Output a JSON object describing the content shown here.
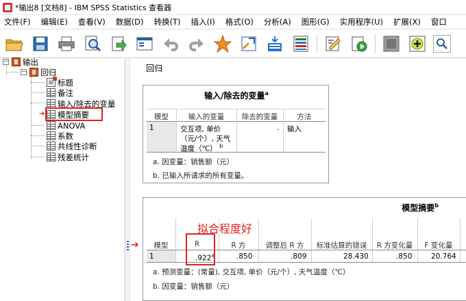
{
  "window": {
    "title": "*输出8 [文档8] - IBM SPSS Statistics 查看器"
  },
  "menu": [
    "文件(F)",
    "编辑(E)",
    "查看(V)",
    "数据(D)",
    "转换(T)",
    "插入(I)",
    "格式(O)",
    "分析(A)",
    "图形(G)",
    "实用程序(U)",
    "扩展(X)",
    "窗口"
  ],
  "toolbar": {
    "icons": [
      "open-folder-icon",
      "save-icon",
      "print-icon",
      "print-preview-icon",
      "export-icon",
      "recall-dialog-icon",
      "undo-icon",
      "redo-icon",
      "goto-data-icon",
      "goto-case-icon",
      "goto-variable-icon",
      "variables-icon",
      "show-all-icon",
      "run-icon",
      "designate-window-icon",
      "insert-icon",
      "search-icon"
    ]
  },
  "navigator": {
    "items": [
      {
        "label": "输出",
        "icon": "book-icon",
        "level": 0
      },
      {
        "label": "回归",
        "icon": "book-icon",
        "level": 1
      },
      {
        "label": "标题",
        "icon": "doc-icon",
        "level": 2
      },
      {
        "label": "备注",
        "icon": "table-icon",
        "level": 2
      },
      {
        "label": "输入/除去的变量",
        "icon": "table-icon",
        "level": 2
      },
      {
        "label": "模型摘要",
        "icon": "table-icon",
        "level": 2,
        "selected": true
      },
      {
        "label": "ANOVA",
        "icon": "table-icon",
        "level": 2
      },
      {
        "label": "系数",
        "icon": "table-icon",
        "level": 2
      },
      {
        "label": "共线性诊断",
        "icon": "table-icon",
        "level": 2
      },
      {
        "label": "残差统计",
        "icon": "table-icon",
        "level": 2
      }
    ]
  },
  "content": {
    "section_title": "回归",
    "table1": {
      "title": "输入/除去的变量",
      "title_sup": "a",
      "headers": [
        "模型",
        "输入的变量",
        "除去的变量",
        "方法"
      ],
      "row": {
        "model": "1",
        "entered_line1": "交互项, 单价",
        "entered_line2": "（元/个）, 天气",
        "entered_line3": "温度（℃）",
        "entered_sup": "b",
        "removed": ".",
        "method": "输入"
      },
      "notes": [
        "a. 因变量：销售额（元）",
        "b. 已输入所请求的所有变量。"
      ]
    },
    "table2": {
      "title": "模型摘要",
      "title_sup": "b",
      "annotation": "拟合程度好",
      "headers": [
        "模型",
        "R",
        "R 方",
        "调整后 R 方",
        "标准估算的错误",
        "R 方变化量",
        "F 变化量"
      ],
      "row": {
        "model": "1",
        "r": ".922",
        "r_sup": "a",
        "r2": ".850",
        "adj_r2": ".809",
        "se": "28.430",
        "r2_change": ".850",
        "f_change": "20.764"
      },
      "notes": [
        "a. 预测变量：(常量), 交互项, 单价（元/个）, 天气温度（℃）",
        "b. 因变量：销售额（元）"
      ]
    }
  }
}
